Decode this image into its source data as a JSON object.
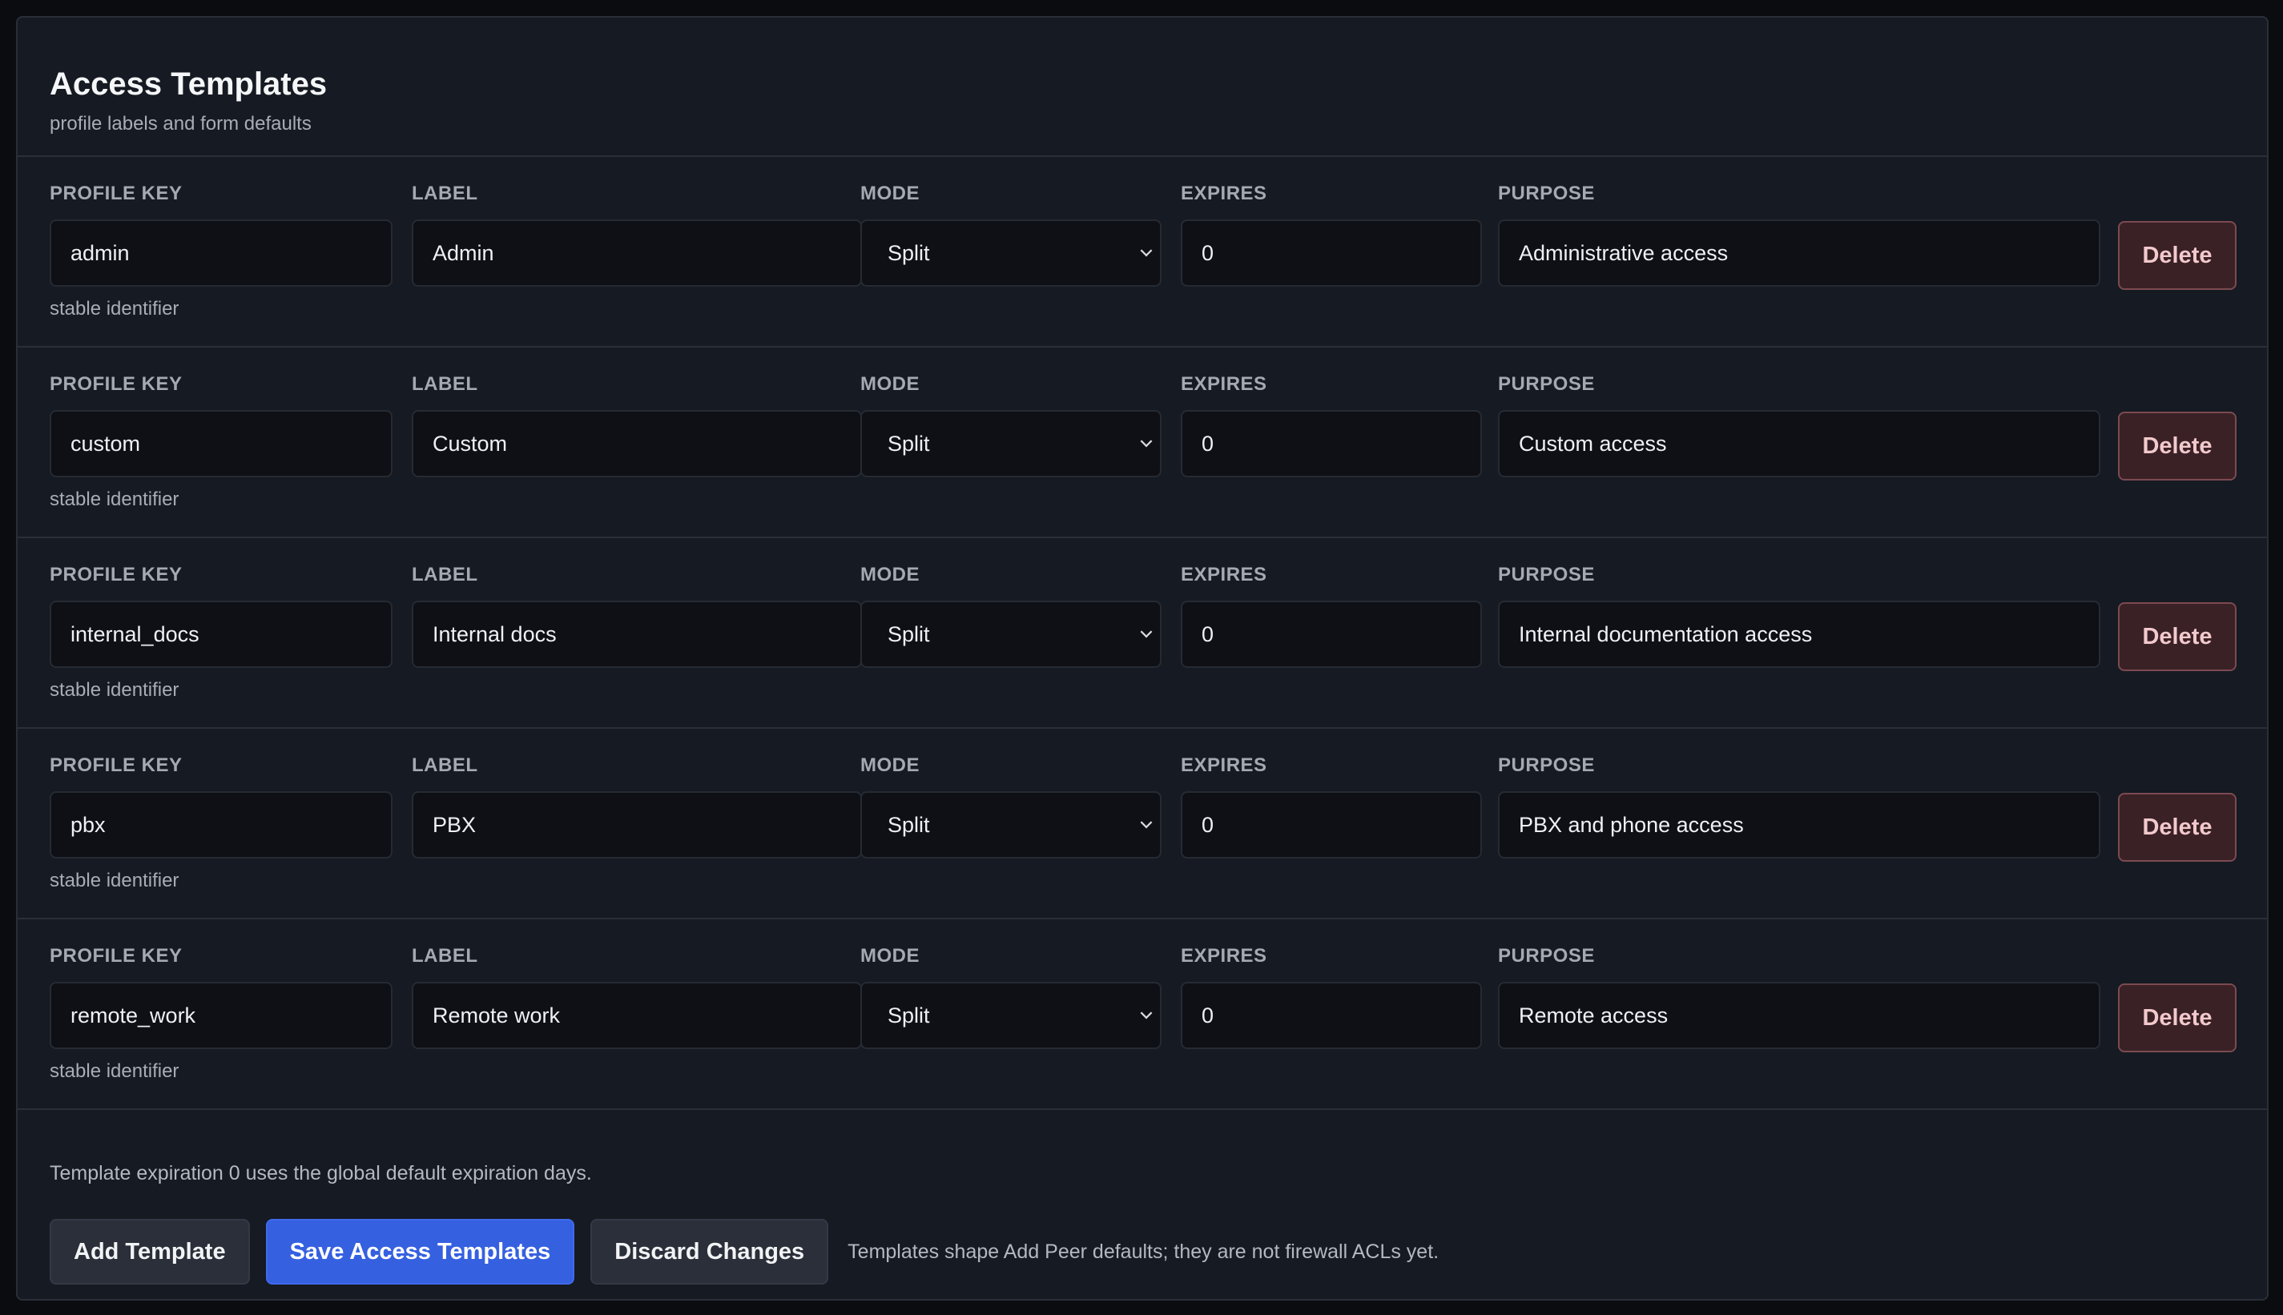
{
  "header": {
    "title": "Access Templates",
    "subtitle": "profile labels and form defaults"
  },
  "columns": {
    "profile_key": "PROFILE KEY",
    "label": "LABEL",
    "mode": "MODE",
    "expires": "EXPIRES",
    "purpose": "PURPOSE"
  },
  "helper_text": "stable identifier",
  "delete_label": "Delete",
  "templates": [
    {
      "key": "admin",
      "label": "Admin",
      "mode": "Split",
      "expires": "0",
      "purpose": "Administrative access"
    },
    {
      "key": "custom",
      "label": "Custom",
      "mode": "Split",
      "expires": "0",
      "purpose": "Custom access"
    },
    {
      "key": "internal_docs",
      "label": "Internal docs",
      "mode": "Split",
      "expires": "0",
      "purpose": "Internal documentation access"
    },
    {
      "key": "pbx",
      "label": "PBX",
      "mode": "Split",
      "expires": "0",
      "purpose": "PBX and phone access"
    },
    {
      "key": "remote_work",
      "label": "Remote work",
      "mode": "Split",
      "expires": "0",
      "purpose": "Remote access"
    }
  ],
  "footer": {
    "note": "Template expiration 0 uses the global default expiration days.",
    "add_label": "Add Template",
    "save_label": "Save Access Templates",
    "discard_label": "Discard Changes",
    "hint": "Templates shape Add Peer defaults; they are not firewall ACLs yet."
  },
  "colors": {
    "primary": "#3560e0",
    "danger_bg": "#3a2126",
    "danger_text": "#f2c9cc"
  }
}
